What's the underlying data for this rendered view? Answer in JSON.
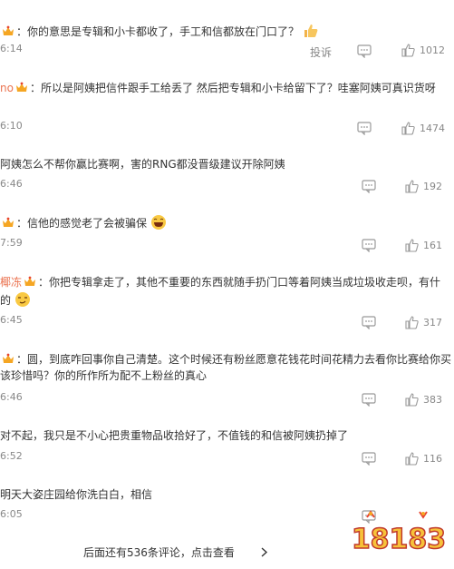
{
  "comments": [
    {
      "name": "",
      "text": "：你的意思是专辑和小卡都收了，手工和信都放在门口了？",
      "time": "6:14",
      "report": "投诉",
      "likes": "1012"
    },
    {
      "name": "no",
      "text": "：所以是阿姨把信件跟手工给丢了 然后把专辑和小卡给留下了？哇塞阿姨可真识货呀",
      "time": "6:10",
      "likes": "1474"
    },
    {
      "name": "",
      "text": "阿姨怎么不帮你赢比赛啊，害的RNG都没晋级建议开除阿姨",
      "time": "6:46",
      "likes": "192"
    },
    {
      "name": "",
      "text": "：信他的感觉老了会被骗保",
      "time": "7:59",
      "likes": "161"
    },
    {
      "name": "椰冻",
      "text_line1": "：你把专辑拿走了，其他不重要的东西就随手扔门口等着阿姨当成垃圾收走呗，有什",
      "text_line2": "的",
      "time": "6:45",
      "likes": "317"
    },
    {
      "name": "",
      "text_line1": "：圆，到底咋回事你自己清楚。这个时候还有粉丝愿意花钱花时间花精力去看你比赛给你买",
      "text_line2": "该珍惜吗？你的所作所为配不上粉丝的真心",
      "time": "6:46",
      "likes": "383"
    },
    {
      "name": "",
      "text": "对不起，我只是不小心把贵重物品收拾好了，不值钱的和信被阿姨扔掉了",
      "time": "6:52",
      "likes": "116"
    },
    {
      "name": "",
      "text": "明天大姿庄园给你洗白白，相信",
      "time": "6:05",
      "likes": ""
    }
  ],
  "footer": {
    "more": "后面还有536条评论，点击查看"
  },
  "watermark": {
    "text": "18183"
  },
  "icons": {
    "comment": "comment-icon",
    "like": "thumbs-up-icon",
    "vip": "crown-badge-icon",
    "more": "chevron-right-icon"
  },
  "colors": {
    "name": "#eb7350",
    "meta": "#888888",
    "text": "#333333"
  }
}
